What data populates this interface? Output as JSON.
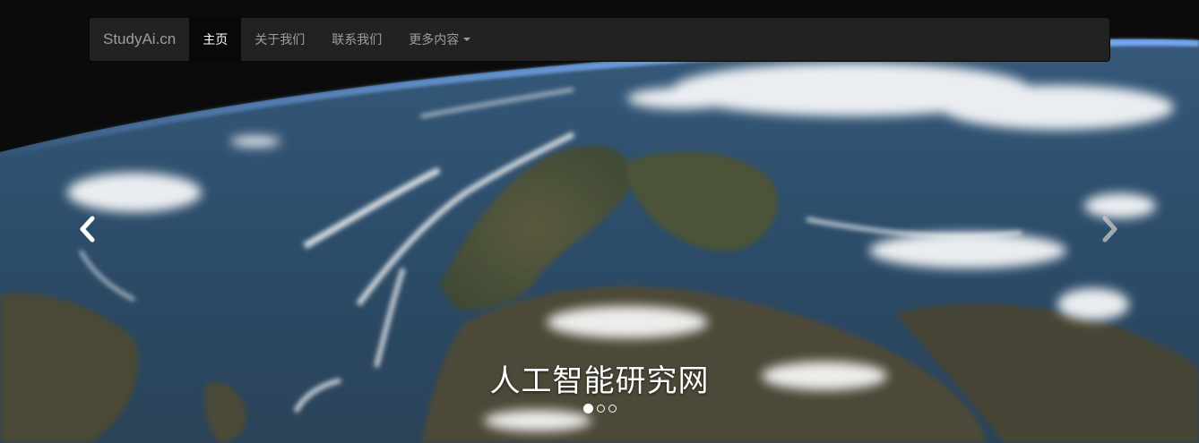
{
  "navbar": {
    "brand": "StudyAi.cn",
    "items": [
      {
        "label": "主页",
        "active": true
      },
      {
        "label": "关于我们",
        "active": false
      },
      {
        "label": "联系我们",
        "active": false
      },
      {
        "label": "更多内容",
        "active": false,
        "dropdown": true
      }
    ]
  },
  "carousel": {
    "caption": "人工智能研究网",
    "slide_count": 3,
    "active_slide": 1,
    "prev_icon": "chevron-left-icon",
    "next_icon": "chevron-right-icon"
  },
  "colors": {
    "navbar_bg": "#222222",
    "navbar_active_bg": "#080808",
    "navbar_text": "#9d9d9d",
    "space": "#0a0a0a",
    "ocean": "#2f4f6e"
  }
}
